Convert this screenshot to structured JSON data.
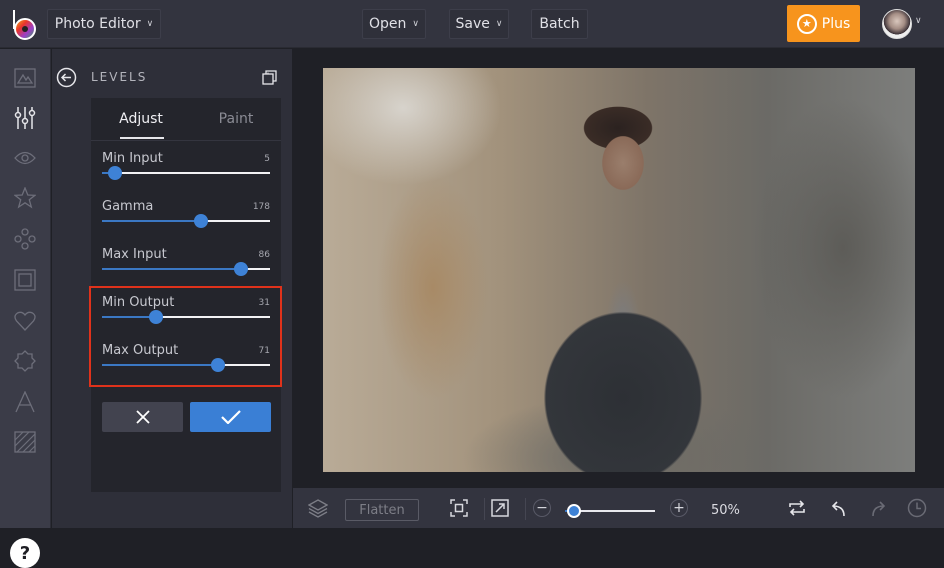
{
  "topbar": {
    "app_menu_label": "Photo Editor",
    "open_label": "Open",
    "save_label": "Save",
    "batch_label": "Batch",
    "plus_label": "Plus",
    "colors": {
      "plus": "#f7941d",
      "bar": "#33343f"
    }
  },
  "sidebar": {
    "items": [
      {
        "name": "image",
        "icon": "image-icon",
        "active": false
      },
      {
        "name": "adjust",
        "icon": "sliders-icon",
        "active": true
      },
      {
        "name": "effects",
        "icon": "eye-icon",
        "active": false
      },
      {
        "name": "favorites",
        "icon": "star-icon",
        "active": false
      },
      {
        "name": "touch-up",
        "icon": "dots-cluster-icon",
        "active": false
      },
      {
        "name": "frames",
        "icon": "frame-icon",
        "active": false
      },
      {
        "name": "graphics",
        "icon": "heart-icon",
        "active": false
      },
      {
        "name": "overlays",
        "icon": "badge-icon",
        "active": false
      },
      {
        "name": "text",
        "icon": "text-a-icon",
        "active": false
      },
      {
        "name": "textures",
        "icon": "hatched-square-icon",
        "active": false
      }
    ],
    "help_label": "?"
  },
  "panel": {
    "title": "LEVELS",
    "tabs": [
      {
        "label": "Adjust",
        "active": true
      },
      {
        "label": "Paint",
        "active": false
      }
    ],
    "sliders": [
      {
        "label": "Min Input",
        "value": "5",
        "fraction": 0.08
      },
      {
        "label": "Gamma",
        "value": "178",
        "fraction": 0.59
      },
      {
        "label": "Max Input",
        "value": "86",
        "fraction": 0.83
      },
      {
        "label": "Min Output",
        "value": "31",
        "fraction": 0.32
      },
      {
        "label": "Max Output",
        "value": "71",
        "fraction": 0.69
      }
    ],
    "highlight_color": "#e0321b",
    "accent_color": "#3a7fd5"
  },
  "bottombar": {
    "flatten_label": "Flatten",
    "zoom_value": "50%",
    "zoom_fraction": 0.1
  }
}
